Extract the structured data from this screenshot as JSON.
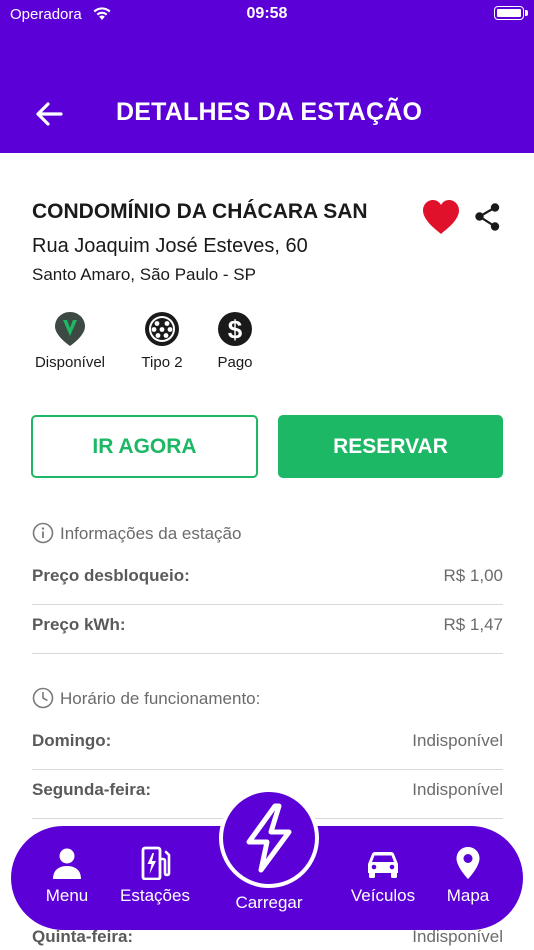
{
  "status_bar": {
    "carrier": "Operadora",
    "time": "09:58"
  },
  "header": {
    "title": "DETALHES DA ESTAÇÃO",
    "back_icon": "arrow-left-icon"
  },
  "station": {
    "name": "CONDOMÍNIO DA CHÁCARA SAN",
    "address": "Rua Joaquim José Esteves, 60",
    "city": "Santo Amaro, São Paulo - SP",
    "favorite": true,
    "features": [
      {
        "icon": "available-pin-icon",
        "label": "Disponível"
      },
      {
        "icon": "type2-connector-icon",
        "label": "Tipo 2"
      },
      {
        "icon": "dollar-icon",
        "label": "Pago"
      }
    ]
  },
  "actions": {
    "go_now": "IR AGORA",
    "reserve": "RESERVAR"
  },
  "station_info": {
    "title": "Informações da estação",
    "rows": [
      {
        "label": "Preço desbloqueio:",
        "value": "R$ 1,00"
      },
      {
        "label": "Preço kWh:",
        "value": "R$ 1,47"
      }
    ]
  },
  "hours": {
    "title": "Horário de funcionamento:",
    "rows": [
      {
        "label": "Domingo:",
        "value": "Indisponível"
      },
      {
        "label": "Segunda-feira:",
        "value": "Indisponível"
      },
      {
        "label": "Quinta-feira:",
        "value": "Indisponível"
      }
    ]
  },
  "nav": {
    "items": [
      {
        "icon": "person-icon",
        "label": "Menu"
      },
      {
        "icon": "charging-station-icon",
        "label": "Estações"
      },
      {
        "icon": "bolt-icon",
        "label": "Carregar"
      },
      {
        "icon": "car-icon",
        "label": "Veículos"
      },
      {
        "icon": "map-pin-icon",
        "label": "Mapa"
      }
    ]
  },
  "colors": {
    "primary": "#5b00d6",
    "green": "#1db865",
    "heart": "#e0112b"
  }
}
